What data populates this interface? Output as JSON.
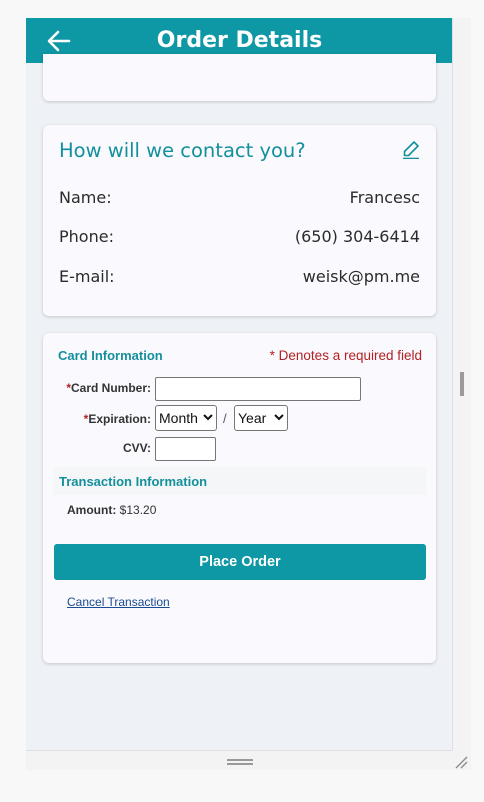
{
  "header": {
    "title": "Order Details",
    "back_icon": "arrow-left-icon"
  },
  "contact": {
    "title": "How will we contact you?",
    "edit_icon": "pencil-icon",
    "rows": [
      {
        "label": "Name:",
        "value": "Francesc"
      },
      {
        "label": "Phone:",
        "value": "(650) 304-6414"
      },
      {
        "label": "E-mail:",
        "value": "weisk@pm.me"
      }
    ]
  },
  "payment": {
    "card_info_title": "Card Information",
    "required_note": "* Denotes a required field",
    "card_number_label": "Card Number:",
    "expiration_label": "Expiration:",
    "month_value": "Month",
    "year_value": "Year",
    "slash": "/",
    "cvv_label": "CVV:",
    "transaction_title": "Transaction Information",
    "amount_label": "Amount:",
    "amount_value": "$13.20",
    "place_order_label": "Place Order",
    "cancel_label": "Cancel Transaction"
  },
  "colors": {
    "accent": "#0e97a4",
    "required": "#b22222",
    "background": "#eef1f6"
  }
}
